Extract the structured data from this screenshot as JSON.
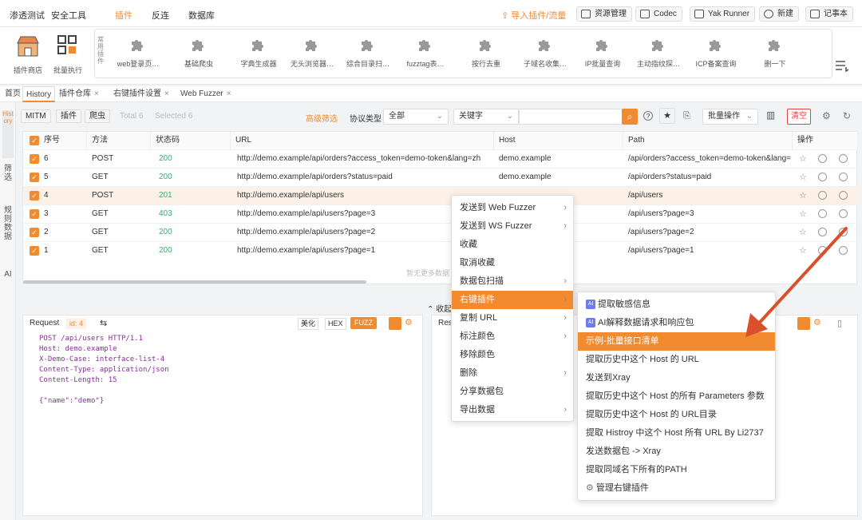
{
  "nav": {
    "items": [
      "渗透测试",
      "安全工具",
      "插件",
      "反连",
      "数据库"
    ],
    "active": "插件",
    "import_label": "导入插件/流量",
    "resource_label": "资源管理",
    "codec_label": "Codec",
    "runner_label": "Yak Runner",
    "new_label": "新建",
    "notes_label": "记事本"
  },
  "tools": [
    {
      "label": "插件商店"
    },
    {
      "label": "批量执行"
    }
  ],
  "plugin_strip": {
    "title": "常用插件",
    "plugins": [
      "web登录页…",
      "基础爬虫",
      "字典生成器",
      "无头浏览器…",
      "综合目录扫…",
      "fuzztag表…",
      "按行去重",
      "子域名收集…",
      "IP批量查询",
      "主动指纹探…",
      "ICP备案查询",
      "删一下"
    ]
  },
  "tabs": [
    {
      "label": "首页"
    },
    {
      "label": "History"
    },
    {
      "label": "插件仓库"
    },
    {
      "label": "右键插件设置"
    },
    {
      "label": "Web Fuzzer"
    }
  ],
  "rail": [
    "History",
    "筛选",
    "规则数据",
    "AI"
  ],
  "toolbar": {
    "mitm": "MITM",
    "plugin": "插件",
    "crawler": "爬虫",
    "total": "Total 6",
    "selected": "Selected 6",
    "advanced": "高级筛选",
    "protocol_label": "协议类型",
    "protocol_value": "全部",
    "keyword_value": "关键字",
    "batch": "批量操作",
    "clear": "清空"
  },
  "table": {
    "headers": [
      "序号",
      "方法",
      "状态码",
      "URL",
      "Host",
      "Path",
      "操作"
    ],
    "rows": [
      {
        "id": "6",
        "method": "POST",
        "status": "200",
        "url": "http://demo.example/api/orders?access_token=demo-token&lang=zh",
        "host": "demo.example",
        "path": "/api/orders?access_token=demo-token&lang="
      },
      {
        "id": "5",
        "method": "GET",
        "status": "200",
        "url": "http://demo.example/api/orders?status=paid",
        "host": "demo.example",
        "path": "/api/orders?status=paid"
      },
      {
        "id": "4",
        "method": "POST",
        "status": "201",
        "url": "http://demo.example/api/users",
        "host": "",
        "path": "/api/users"
      },
      {
        "id": "3",
        "method": "GET",
        "status": "403",
        "url": "http://demo.example/api/users?page=3",
        "host": "",
        "path": "/api/users?page=3"
      },
      {
        "id": "2",
        "method": "GET",
        "status": "200",
        "url": "http://demo.example/api/users?page=2",
        "host": "",
        "path": "/api/users?page=2"
      },
      {
        "id": "1",
        "method": "GET",
        "status": "200",
        "url": "http://demo.example/api/users?page=1",
        "host": "",
        "path": "/api/users?page=1"
      }
    ],
    "footer": "暂无更多数据"
  },
  "request": {
    "title": "Request",
    "id_badge": "id: 4",
    "beautify": "美化",
    "hex": "HEX",
    "fuzz": "FUZZ",
    "lines": [
      "POST /api/users HTTP/1.1",
      "Host: demo.example",
      "X-Demo-Case: interface-list-4",
      "Content-Type: application/json",
      "Content-Length: 15",
      "",
      "{\"name\":\"demo\"}"
    ]
  },
  "response": {
    "title": "Res"
  },
  "collapse": "收起",
  "context_menu": [
    {
      "label": "发送到 Web Fuzzer",
      "sub": true
    },
    {
      "label": "发送到 WS Fuzzer",
      "sub": true
    },
    {
      "label": "收藏",
      "sub": false
    },
    {
      "label": "取消收藏",
      "sub": false
    },
    {
      "label": "数据包扫描",
      "sub": true
    },
    {
      "label": "右键插件",
      "sub": true
    },
    {
      "label": "复制 URL",
      "sub": true
    },
    {
      "label": "标注颜色",
      "sub": true
    },
    {
      "label": "移除颜色",
      "sub": false
    },
    {
      "label": "删除",
      "sub": true
    },
    {
      "label": "分享数据包",
      "sub": false
    },
    {
      "label": "导出数据",
      "sub": true
    }
  ],
  "submenu": [
    "提取敏感信息",
    "AI解释数据请求和响应包",
    "示例-批量接口清单",
    "提取历史中这个 Host 的 URL",
    "发送到Xray",
    "提取历史中这个 Host 的所有 Parameters 参数",
    "提取历史中这个 Host 的 URL目录",
    "提取 Histroy 中这个 Host 所有 URL By Li2737",
    "发送数据包 -> Xray",
    "提取同域名下所有的PATH",
    "管理右键插件"
  ],
  "colors": {
    "accent": "#f28b30",
    "annotation_arrow": "#d9502b",
    "ai_badge": "#6d7cf0"
  }
}
